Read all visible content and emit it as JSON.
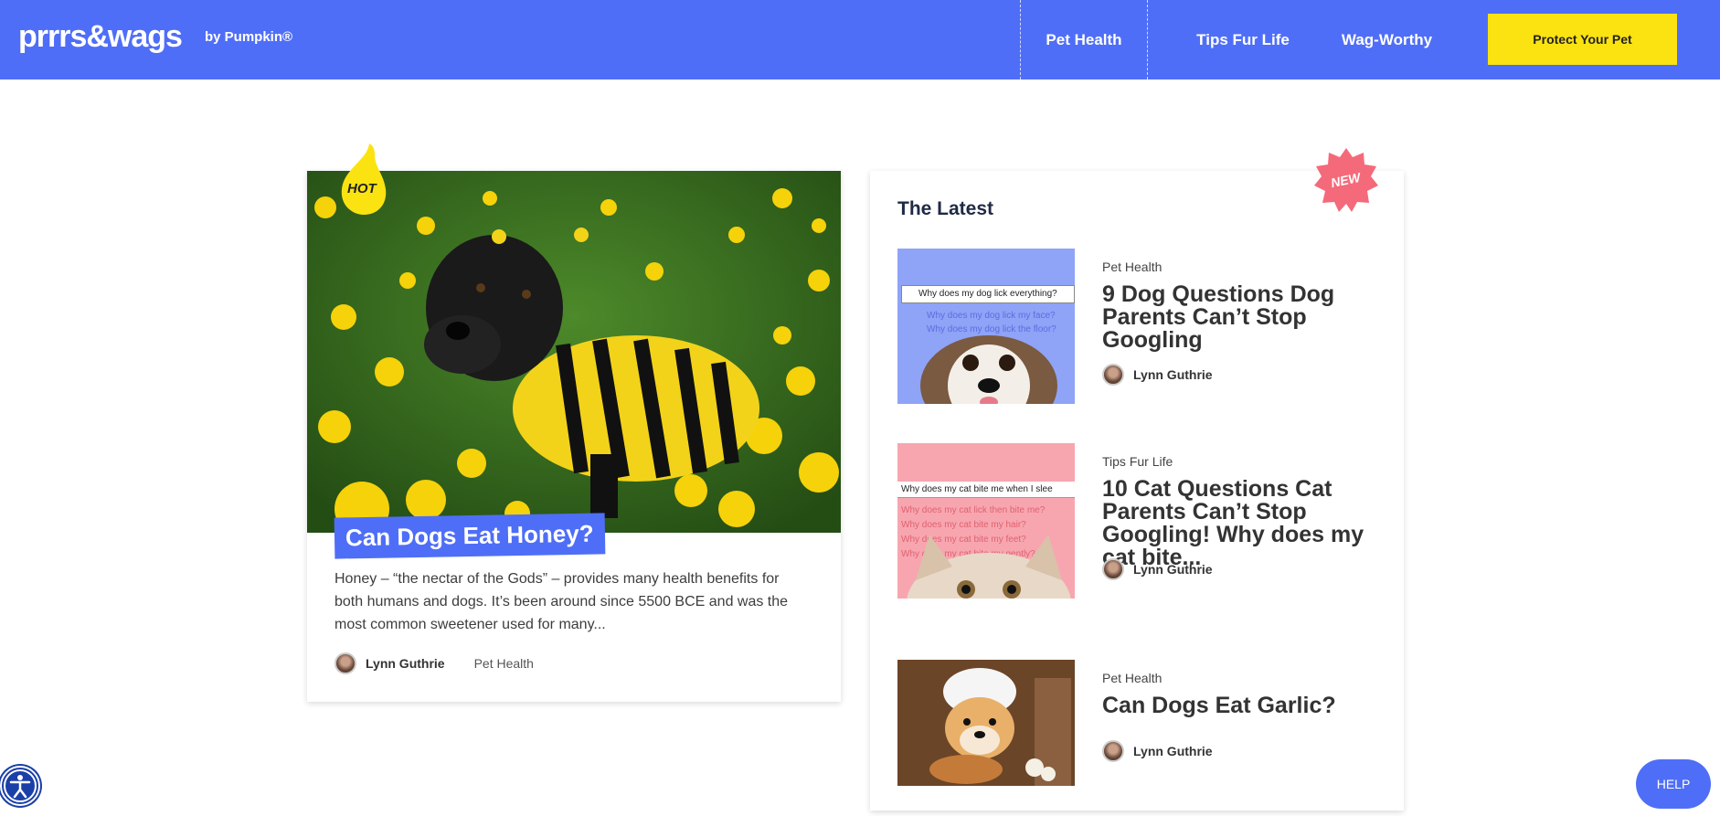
{
  "header": {
    "logo": "prrrs&wags",
    "logo_by": "by Pumpkin®",
    "nav": [
      "Pet Health",
      "Tips Fur Life",
      "Wag-Worthy"
    ],
    "cta": "Protect Your Pet",
    "colors": {
      "brand": "#4f6ef7",
      "cta": "#fbe312"
    }
  },
  "featured": {
    "badge": "HOT",
    "title": "Can Dogs Eat Honey?",
    "excerpt": "Honey – “the nectar of the Gods” – provides many health benefits for both humans and dogs. It’s been around since 5500 BCE and was the most common sweetener used for many...",
    "author": "Lynn Guthrie",
    "category": "Pet Health"
  },
  "latest": {
    "heading": "The Latest",
    "badge": "NEW",
    "items": [
      {
        "category": "Pet Health",
        "title": "9 Dog Questions Dog Parents Can’t Stop Googling",
        "author": "Lynn Guthrie",
        "thumb_search": "Why does my dog lick everything?",
        "thumb_lines": [
          "Why does my dog lick my face?",
          "Why does my dog lick the floor?"
        ]
      },
      {
        "category": "Tips Fur Life",
        "title": "10 Cat Questions Cat Parents Can’t Stop Googling! Why does my cat bite...",
        "author": "Lynn Guthrie",
        "thumb_search": "Why does my cat bite me when I slee",
        "thumb_lines": [
          "Why does my cat lick then bite me?",
          "Why does my cat bite my hair?",
          "Why does my cat bite my feet?",
          "Why does my cat bite my gently?"
        ]
      },
      {
        "category": "Pet Health",
        "title": "Can Dogs Eat Garlic?",
        "author": "Lynn Guthrie"
      }
    ]
  },
  "help": "HELP"
}
